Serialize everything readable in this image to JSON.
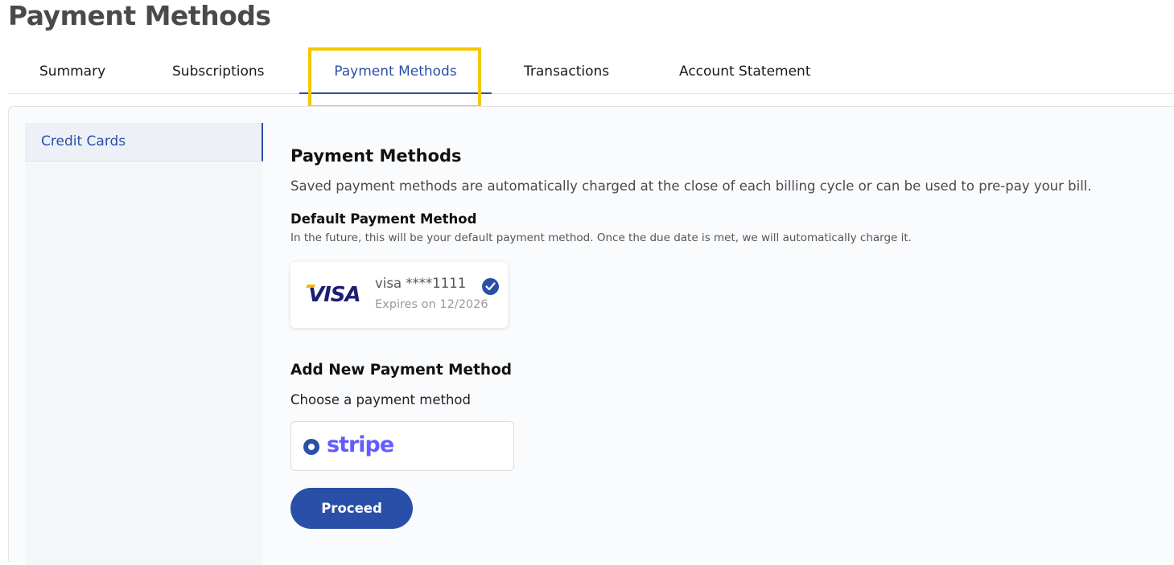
{
  "page": {
    "title": "Payment Methods"
  },
  "tabs": [
    {
      "label": "Summary"
    },
    {
      "label": "Subscriptions"
    },
    {
      "label": "Payment Methods",
      "active": true
    },
    {
      "label": "Transactions"
    },
    {
      "label": "Account Statement"
    }
  ],
  "sidebar": {
    "items": [
      {
        "label": "Credit Cards",
        "active": true
      }
    ]
  },
  "content": {
    "heading": "Payment Methods",
    "description": "Saved payment methods are automatically charged at the close of each billing cycle or can be used to pre-pay your bill.",
    "default_section": {
      "heading": "Default Payment Method",
      "description": "In the future, this will be your default payment method. Once the due date is met, we will automatically charge it.",
      "card": {
        "brand_logo": "VISA",
        "number": "visa ****1111",
        "expiry": "Expires on 12/2026",
        "selected": true
      }
    },
    "add_section": {
      "heading": "Add New Payment Method",
      "choose_label": "Choose a payment method",
      "options": [
        {
          "logo": "stripe",
          "selected": true
        }
      ],
      "proceed_label": "Proceed"
    }
  },
  "colors": {
    "accent": "#2a4fa8",
    "highlight": "#f5c800",
    "stripe": "#635bff",
    "visa": "#1a1f71"
  }
}
